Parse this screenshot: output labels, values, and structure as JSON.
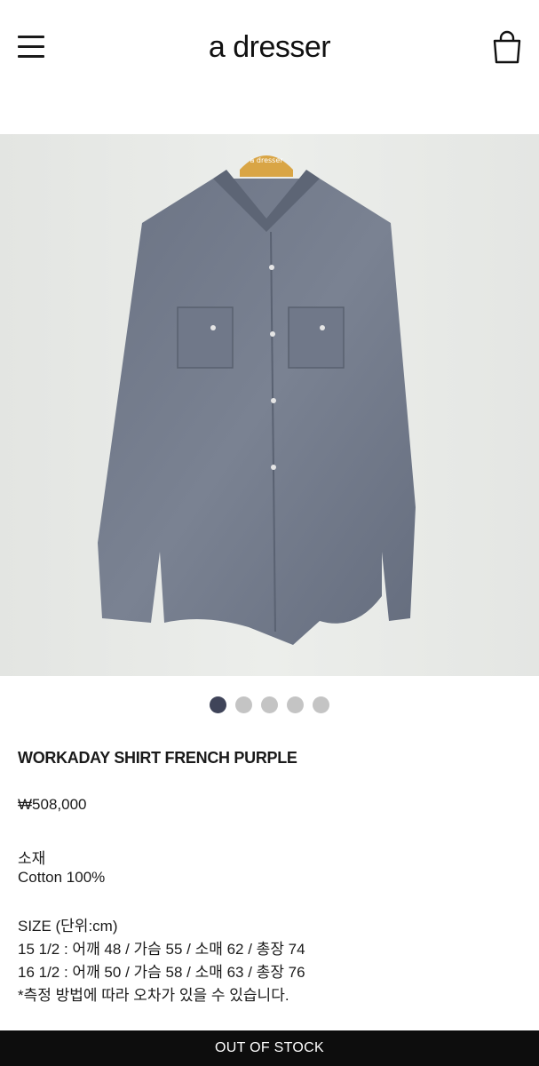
{
  "header": {
    "logo": "a dresser",
    "menu_icon": "hamburger-menu-icon",
    "cart_icon": "shopping-bag-icon"
  },
  "gallery": {
    "slide_count": 5,
    "active_index": 0,
    "hanger_text": "a dresser"
  },
  "product": {
    "title": "WORKADAY SHIRT FRENCH PURPLE",
    "price": "₩508,000",
    "material_label": "소재",
    "material_value": "Cotton 100%",
    "size_heading": "SIZE (단위:cm)",
    "size_rows": [
      "15 1/2 : 어깨 48 / 가슴 55 / 소매 62 / 총장 74",
      "16 1/2 : 어깨 50 / 가슴 58 / 소매 63 / 총장 76"
    ],
    "note": "*측정 방법에 따라 오차가 있을 수 있습니다."
  },
  "cta": {
    "label": "OUT OF STOCK"
  },
  "colors": {
    "active_dot": "#3f4459",
    "inactive_dot": "#c4c4c4",
    "cta_bg": "#0d0d0d"
  }
}
